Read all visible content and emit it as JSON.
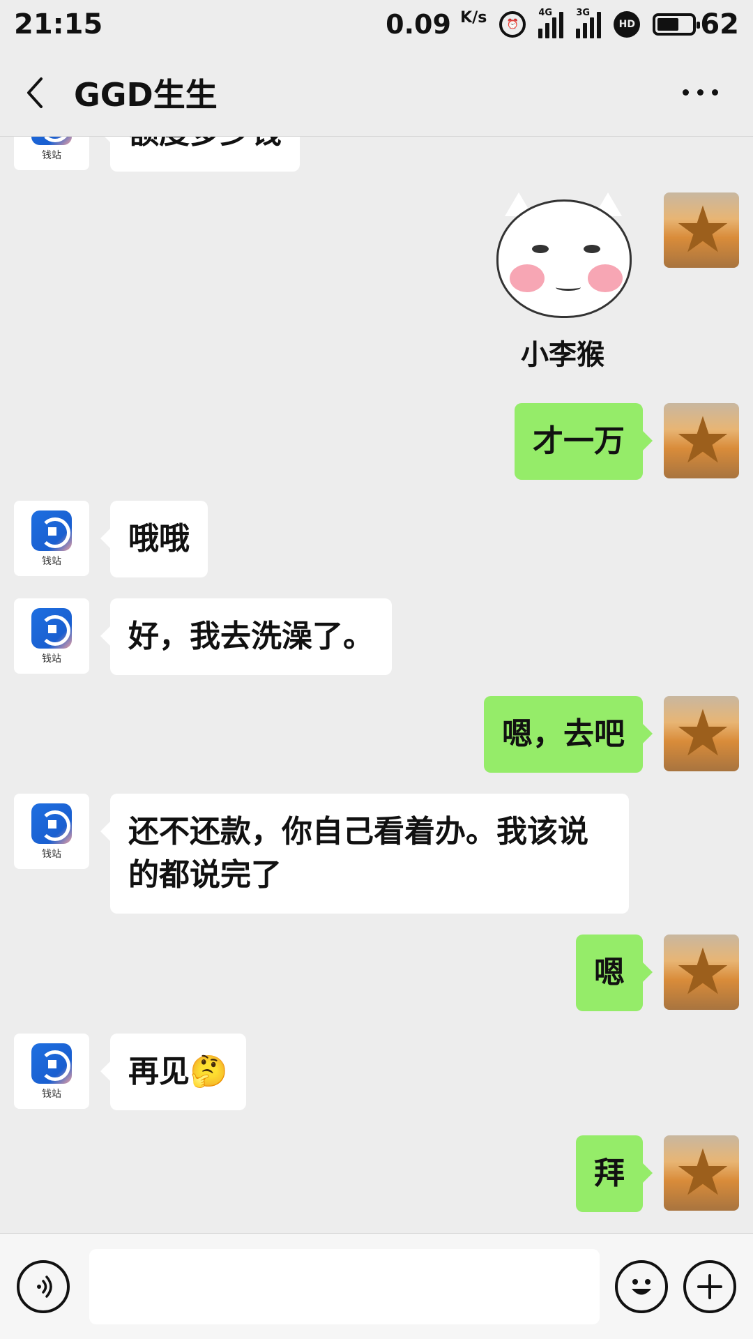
{
  "status_bar": {
    "time": "21:15",
    "net_speed": "0.09",
    "net_unit": "K/s",
    "sim1_tag": "4G",
    "sim2_tag": "3G",
    "hd_label": "HD",
    "battery_level": 62,
    "battery_text": "62"
  },
  "header": {
    "title": "GGD生生"
  },
  "contact": {
    "app_name": "钱站"
  },
  "messages": [
    {
      "side": "in",
      "text": "额度多少钱"
    },
    {
      "side": "out",
      "type": "sticker",
      "caption": "小李猴"
    },
    {
      "side": "out",
      "text": "才一万"
    },
    {
      "side": "in",
      "text": "哦哦"
    },
    {
      "side": "in",
      "text": "好，我去洗澡了。"
    },
    {
      "side": "out",
      "text": "嗯，去吧"
    },
    {
      "side": "in",
      "text": "还不还款，你自己看着办。我该说的都说完了"
    },
    {
      "side": "out",
      "text": "嗯"
    },
    {
      "side": "in",
      "text": "再见🤔"
    },
    {
      "side": "out",
      "text": "拜"
    }
  ],
  "input": {
    "value": "",
    "placeholder": ""
  },
  "icons": {
    "back": "chevron-left-icon",
    "more": "more-icon",
    "voice": "voice-icon",
    "emoji": "emoji-icon",
    "plus": "plus-icon"
  },
  "colors": {
    "background": "#ededed",
    "outgoing_bubble": "#95ec69",
    "incoming_bubble": "#ffffff"
  }
}
